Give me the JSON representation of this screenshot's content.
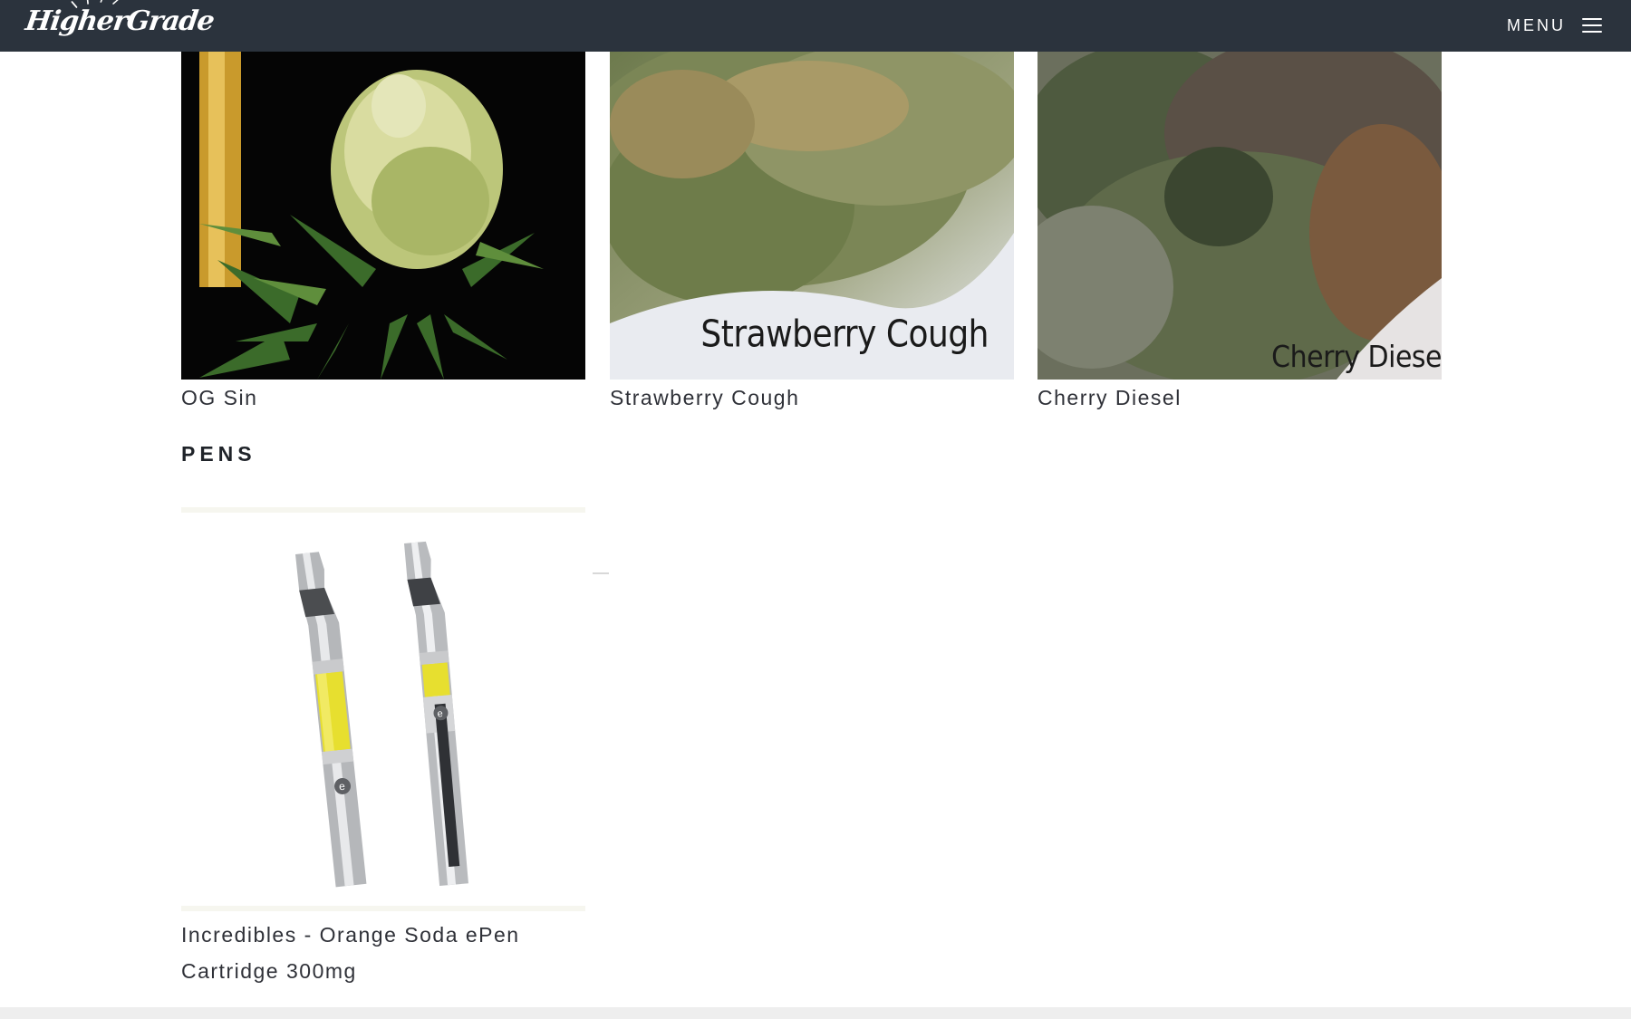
{
  "header": {
    "logo_text": "HigherGrade",
    "menu_label": "MENU",
    "background": "#2b333d"
  },
  "products_top": [
    {
      "title": "OG Sin"
    },
    {
      "title": "Strawberry Cough",
      "image_caption": "Strawberry Cough"
    },
    {
      "title": "Cherry Diesel",
      "image_caption": "Cherry Diese"
    }
  ],
  "pens_section": {
    "heading": "PENS",
    "products": [
      {
        "title_line1": "Incredibles - Orange Soda ePen",
        "title_line2": "Cartridge 300mg"
      }
    ]
  },
  "icons": {
    "menu": "hamburger-icon"
  }
}
